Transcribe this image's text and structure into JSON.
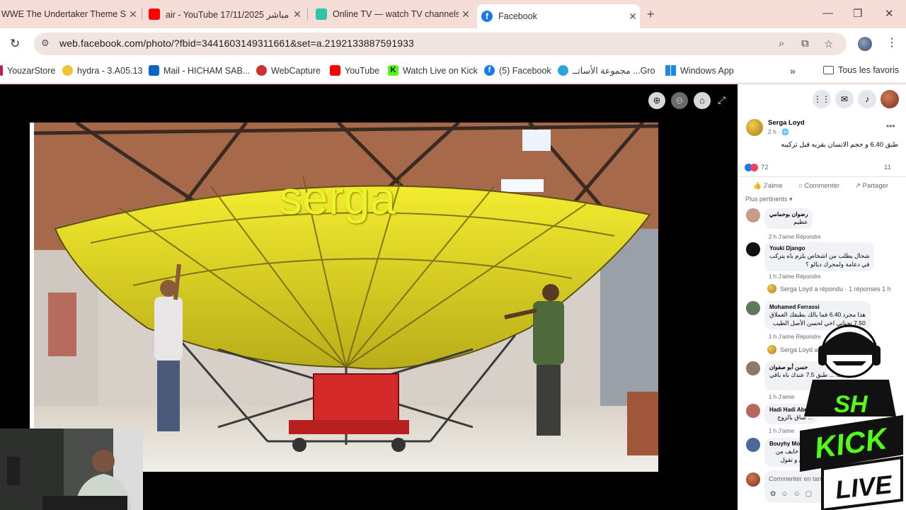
{
  "tabs": [
    {
      "title": "WWE The Undertaker Theme So",
      "favicon": "wwe-icon"
    },
    {
      "title": "air - YouTube مباشر 17/11/2025",
      "favicon": "youtube-icon"
    },
    {
      "title": "Online TV — watch TV channels",
      "favicon": "online-tv-icon"
    },
    {
      "title": "Facebook",
      "favicon": "facebook-icon",
      "active": true
    }
  ],
  "new_tab": "+",
  "window_controls": {
    "minimize": "—",
    "restore": "❐",
    "close": "✕"
  },
  "address": {
    "url": "web.facebook.com/photo/?fbid=3441603149311661&set=a.2192133887591933"
  },
  "bookmarks": [
    {
      "label": "YouzarStore",
      "icon": "store-icon"
    },
    {
      "label": "hydra - 3.A05.13",
      "icon": "hydra-icon"
    },
    {
      "label": "Mail - HICHAM SAB...",
      "icon": "outlook-icon"
    },
    {
      "label": "WebCapture",
      "icon": "webcapture-icon"
    },
    {
      "label": "YouTube",
      "icon": "youtube-icon"
    },
    {
      "label": "Watch Live on Kick",
      "icon": "kick-icon"
    },
    {
      "label": "(5) Facebook",
      "icon": "facebook-icon"
    },
    {
      "label": "مجموعة الأساتــ ...Gro",
      "icon": "telegram-icon"
    },
    {
      "label": "Windows App",
      "icon": "windows-icon"
    }
  ],
  "bookmarks_more": "»",
  "all_bookmarks": "Tous les favoris",
  "photo": {
    "watermark": "serga"
  },
  "post": {
    "author": "Serga Loyd",
    "time": "2 h · 🌐",
    "text": "طبق 6.40 و حجم الانسان بقربه قبل تركيبه",
    "reactions_count": "72",
    "comments_count": "11",
    "actions": {
      "like": "J'aime",
      "comment": "Commenter",
      "share": "Partager"
    },
    "sort": "Plus pertinents ▾"
  },
  "comments": [
    {
      "name": "رضوان بوحمامي",
      "text": [
        "عظيم"
      ],
      "meta": "2 h   J'aime   Répondre"
    },
    {
      "name": "Youki Django",
      "text": [
        "شحال يطلب من اشخاص يلزم باه يتركب",
        "في دعامة ولمحرك ديالو ؟"
      ],
      "meta": "1 h   J'aime   Répondre",
      "reply": "Serga Loyd a répondu · 1 réponses  1 h"
    },
    {
      "name": "Mohamed Ferrassi",
      "text": [
        "هذا مجرد 6.40 فما بالك بطبقك العملاق",
        "7.50 تحياتي اخي لحسن الأصل الطيب"
      ],
      "meta": "1 h   J'aime   Répondre",
      "reply": "Serga Loyd a répondu · 1 réponses"
    },
    {
      "name": "حسن أبو صفوان",
      "text": [
        "هذا ... طبق 7.5 عندك باه باقي",
        "... كنتسنا"
      ],
      "meta": "1 h   J'aime"
    },
    {
      "name": "Hadi Hadi Abd...",
      "text": [
        "... ساق بالزوج"
      ],
      "meta": "1 h   J'aime"
    },
    {
      "name": "Bouyhy Moro...",
      "text": [
        "... لا خايف من",
        "... ي و تقول"
      ],
      "meta": "1 h   J'aime   Répondre"
    }
  ],
  "composer": {
    "placeholder": "Commenter en tant que ..."
  },
  "overlay": {
    "brand_top": "SH",
    "brand_mid": "KICK",
    "brand_bottom": "LIVE"
  }
}
